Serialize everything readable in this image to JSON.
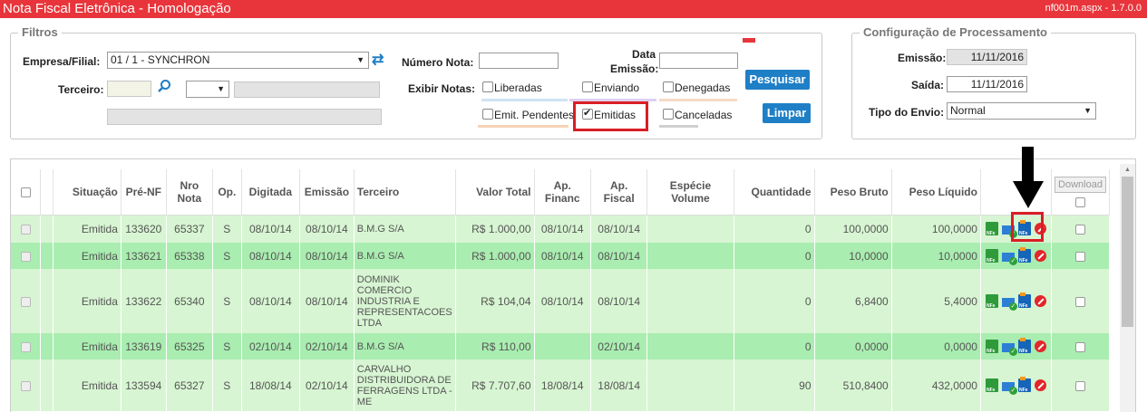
{
  "title": "Nota Fiscal Eletrônica - Homologação",
  "version": "nf001m.aspx - 1.7.0.0",
  "filters": {
    "legend": "Filtros",
    "empresa_label": "Empresa/Filial:",
    "empresa_value": "01 / 1 - SYNCHRON",
    "terceiro_label": "Terceiro:",
    "terceiro_value": "",
    "numero_nota_label": "Número Nota:",
    "numero_nota_value": "",
    "data_emissao_label_1": "Data",
    "data_emissao_label_2": "Emissão:",
    "data_emissao_value": "",
    "exibir_label": "Exibir Notas:",
    "checkboxes": [
      {
        "label": "Liberadas",
        "checked": false,
        "color": "#cfe3f5"
      },
      {
        "label": "Enviando",
        "checked": false,
        "color": "#ddd0ef"
      },
      {
        "label": "Denegadas",
        "checked": false,
        "color": "#f6d9c6"
      },
      {
        "label": "Emit. Pendentes",
        "checked": false,
        "color": "#f8d2b6"
      },
      {
        "label": "Emitidas",
        "checked": true,
        "color": "#cfe9c8"
      },
      {
        "label": "Canceladas",
        "checked": false,
        "color": "#d0d0d0"
      }
    ],
    "pesquisar_label": "Pesquisar",
    "limpar_label": "Limpar"
  },
  "config": {
    "legend": "Configuração de Processamento",
    "emissao_label": "Emissão:",
    "emissao_value": "11/11/2016",
    "saida_label": "Saída:",
    "saida_value": "11/11/2016",
    "tipo_label": "Tipo do Envio:",
    "tipo_value": "Normal"
  },
  "grid": {
    "headers": {
      "situacao": "Situação",
      "pre_nf": "Pré-NF",
      "nro_nota_1": "Nro",
      "nro_nota_2": "Nota",
      "op": "Op.",
      "digitada": "Digitada",
      "emissao": "Emissão",
      "terceiro": "Terceiro",
      "valor_total": "Valor Total",
      "ap_financ_1": "Ap.",
      "ap_financ_2": "Financ",
      "ap_fiscal": "Ap. Fiscal",
      "especie_1": "Espécie",
      "especie_2": "Volume",
      "quantidade": "Quantidade",
      "peso_bruto": "Peso Bruto",
      "peso_liquido": "Peso Líquido",
      "download": "Download"
    },
    "rows": [
      {
        "situacao": "Emitida",
        "pre_nf": "133620",
        "nro": "65337",
        "op": "S",
        "digitada": "08/10/14",
        "emissao": "08/10/14",
        "terceiro": "B.M.G S/A",
        "valor": "R$ 1.000,00",
        "ap_financ": "08/10/14",
        "ap_fiscal": "08/10/14",
        "especie": "",
        "quantidade": "0",
        "peso_bruto": "100,0000",
        "peso_liquido": "100,0000"
      },
      {
        "situacao": "Emitida",
        "pre_nf": "133621",
        "nro": "65338",
        "op": "S",
        "digitada": "08/10/14",
        "emissao": "08/10/14",
        "terceiro": "B.M.G S/A",
        "valor": "R$ 1.000,00",
        "ap_financ": "08/10/14",
        "ap_fiscal": "08/10/14",
        "especie": "",
        "quantidade": "0",
        "peso_bruto": "10,0000",
        "peso_liquido": "10,0000"
      },
      {
        "situacao": "Emitida",
        "pre_nf": "133622",
        "nro": "65340",
        "op": "S",
        "digitada": "08/10/14",
        "emissao": "08/10/14",
        "terceiro": "DOMINIK COMERCIO INDUSTRIA E REPRESENTACOES LTDA",
        "valor": "R$ 104,04",
        "ap_financ": "08/10/14",
        "ap_fiscal": "08/10/14",
        "especie": "",
        "quantidade": "0",
        "peso_bruto": "6,8400",
        "peso_liquido": "5,4000"
      },
      {
        "situacao": "Emitida",
        "pre_nf": "133619",
        "nro": "65325",
        "op": "S",
        "digitada": "02/10/14",
        "emissao": "02/10/14",
        "terceiro": "B.M.G S/A",
        "valor": "R$ 110,00",
        "ap_financ": "",
        "ap_fiscal": "02/10/14",
        "especie": "",
        "quantidade": "0",
        "peso_bruto": "0,0000",
        "peso_liquido": "0,0000"
      },
      {
        "situacao": "Emitida",
        "pre_nf": "133594",
        "nro": "65327",
        "op": "S",
        "digitada": "18/08/14",
        "emissao": "02/10/14",
        "terceiro": "CARVALHO DISTRIBUIDORA DE FERRAGENS LTDA - ME",
        "valor": "R$ 7.707,60",
        "ap_financ": "18/08/14",
        "ap_fiscal": "18/08/14",
        "especie": "",
        "quantidade": "90",
        "peso_bruto": "510,8400",
        "peso_liquido": "432,0000"
      }
    ]
  },
  "colors": {
    "titlebar": "#e8353b",
    "button": "#1f7fc6",
    "row_light": "#d7f5d2",
    "row_dark": "#a9edb0",
    "highlight": "#d91e25"
  }
}
